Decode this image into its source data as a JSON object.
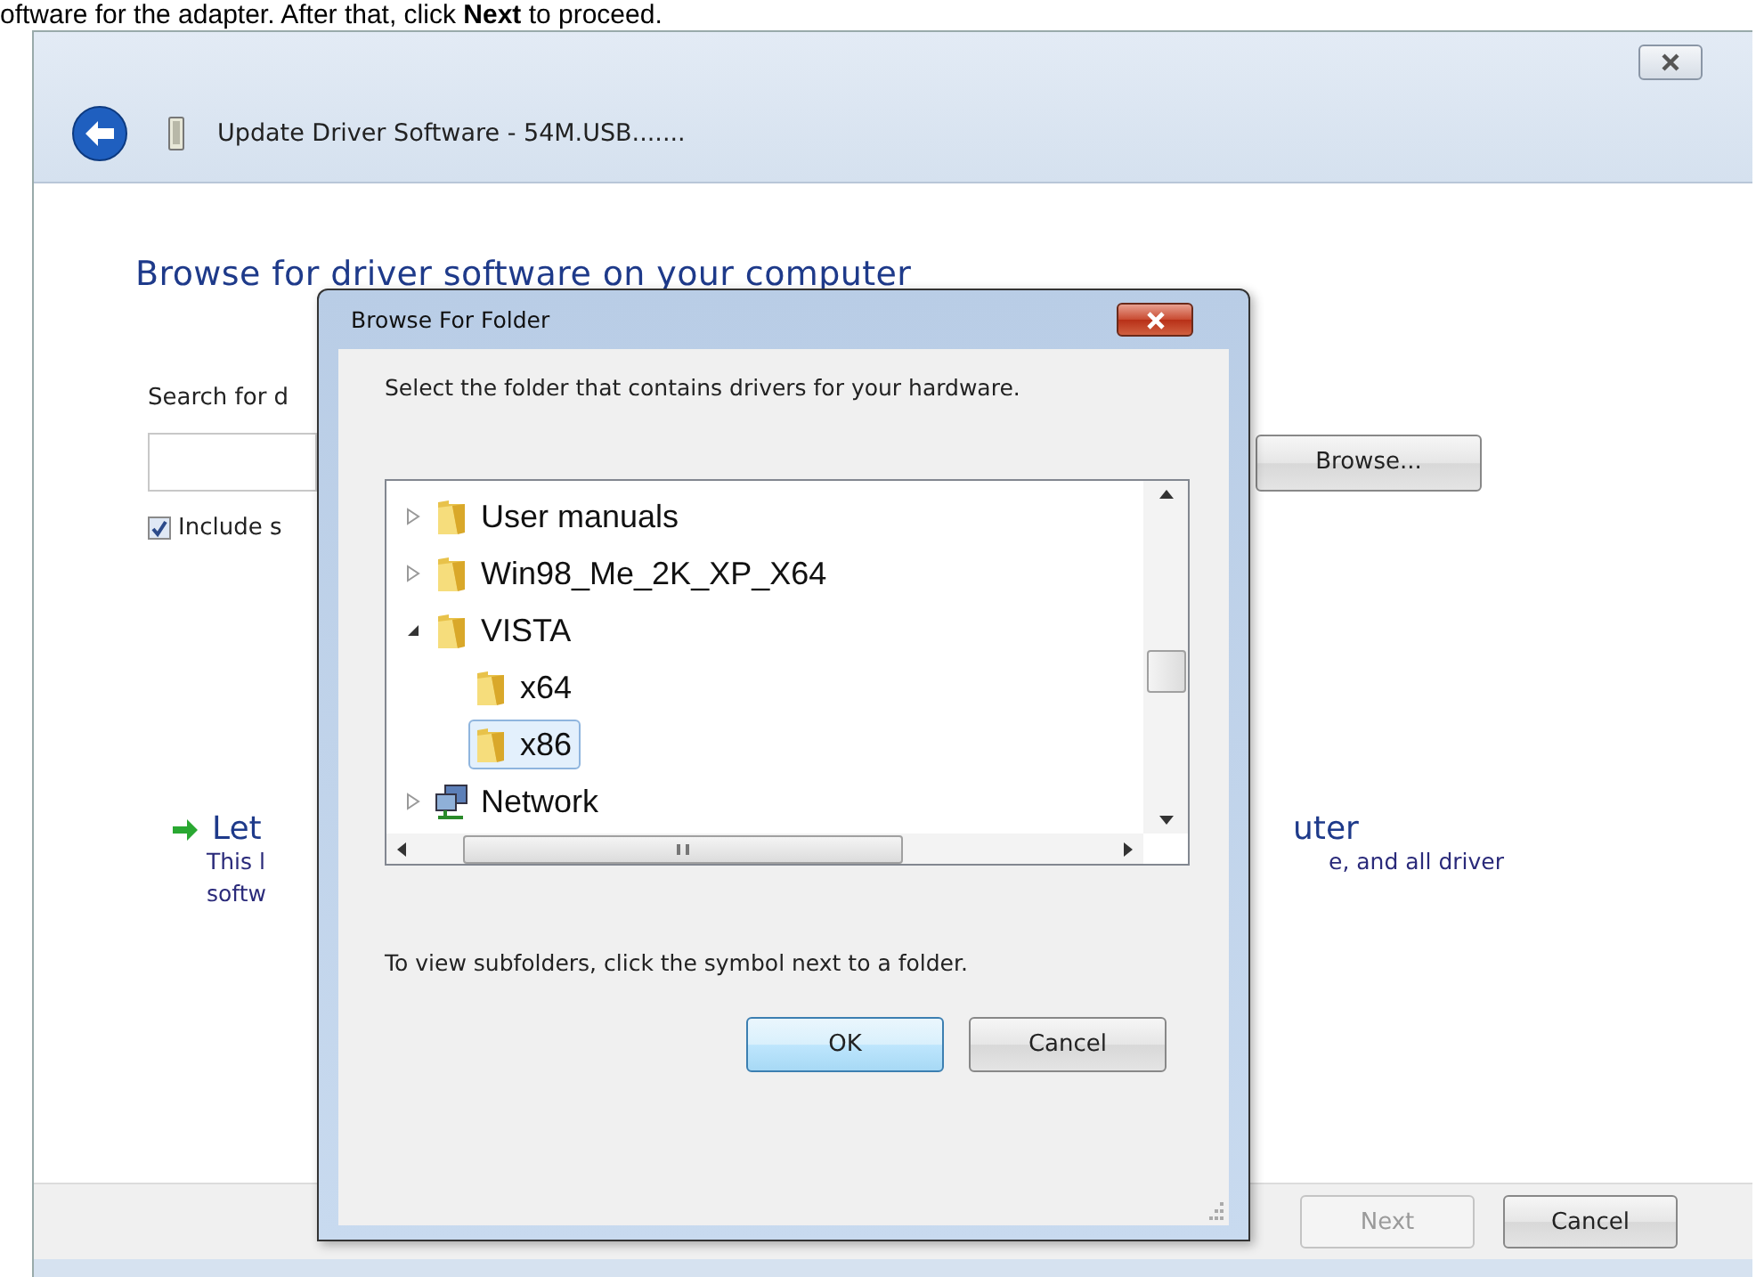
{
  "page_text": "oftware for the adapter. After that, click **Next** to proceed.",
  "window": {
    "title": "Update Driver Software - 54M.USB......."
  },
  "content": {
    "heading": "Browse for driver software on your computer",
    "search_label": "Search for d",
    "include": {
      "label": "Include s",
      "checked": true
    },
    "browse_button": "Browse...",
    "option": {
      "title_left": "Let",
      "title_right": "uter",
      "desc_left_1": "This l",
      "desc_right_1": "e, and all driver",
      "desc_left_2": "softw"
    }
  },
  "footer": {
    "buttons": [
      {
        "label": "Next",
        "disabled": true
      },
      {
        "label": "Cancel",
        "disabled": false
      }
    ]
  },
  "dialog": {
    "title": "Browse For Folder",
    "instruction": "Select the folder that contains drivers for your hardware.",
    "tree": [
      {
        "label": "User manuals",
        "kind": "folder",
        "expanded": false,
        "selected": false
      },
      {
        "label": "Win98_Me_2K_XP_X64",
        "kind": "folder",
        "expanded": false,
        "selected": false
      },
      {
        "label": "VISTA",
        "kind": "folder",
        "expanded": true,
        "selected": false,
        "children": [
          {
            "label": "x64",
            "kind": "folder",
            "selected": false
          },
          {
            "label": "x86",
            "kind": "folder",
            "selected": true
          }
        ]
      },
      {
        "label": "Network",
        "kind": "network",
        "expanded": false,
        "selected": false
      }
    ],
    "hint": "To view subfolders, click the symbol next to a folder.",
    "buttons": [
      {
        "label": "OK",
        "default": true
      },
      {
        "label": "Cancel",
        "default": false
      }
    ]
  }
}
